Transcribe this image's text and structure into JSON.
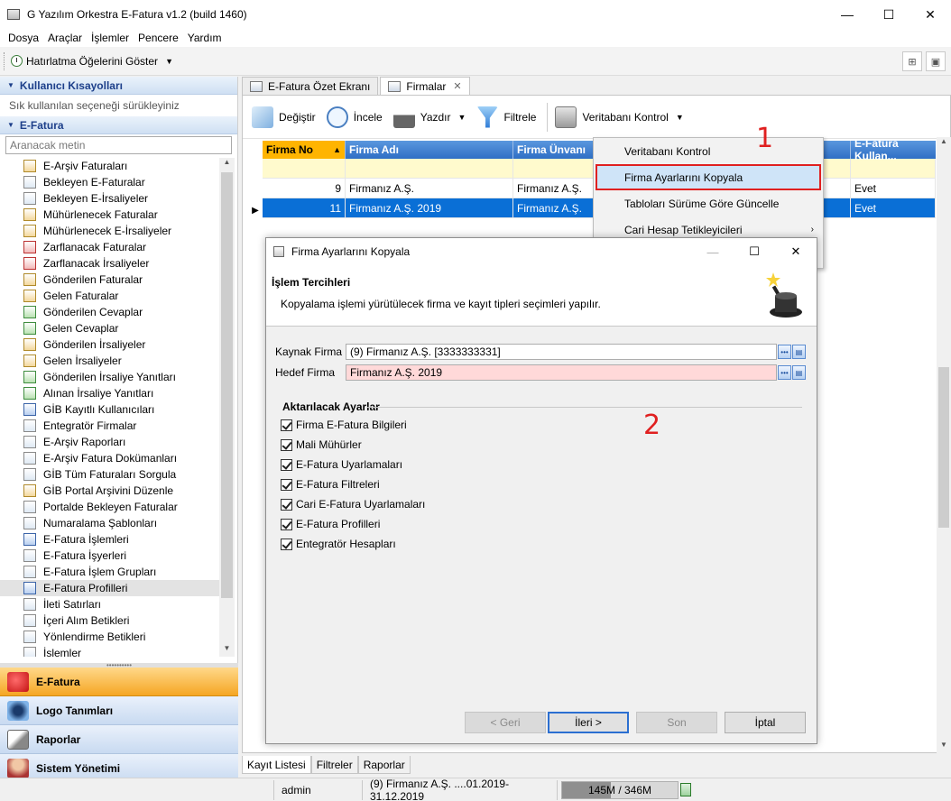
{
  "window": {
    "title": "G Yazılım Orkestra E-Fatura v1.2 (build 1460)",
    "minimize": "—",
    "maximize": "☐",
    "close": "✕"
  },
  "menu": [
    "Dosya",
    "Araçlar",
    "İşlemler",
    "Pencere",
    "Yardım"
  ],
  "topbar": {
    "reminder": "Hatırlatma Öğelerini Göster"
  },
  "left": {
    "shortcuts_title": "Kullanıcı Kısayolları",
    "shortcuts_hint": "Sık kullanılan seçeneği sürükleyiniz",
    "efatura_title": "E-Fatura",
    "search_placeholder": "Aranacak metin",
    "items": [
      "E-Arşiv Faturaları",
      "Bekleyen E-Faturalar",
      "Bekleyen E-İrsaliyeler",
      "Mühürlenecek Faturalar",
      "Mühürlenecek E-İrsaliyeler",
      "Zarflanacak Faturalar",
      "Zarflanacak İrsaliyeler",
      "Gönderilen Faturalar",
      "Gelen Faturalar",
      "Gönderilen Cevaplar",
      "Gelen Cevaplar",
      "Gönderilen İrsaliyeler",
      "Gelen İrsaliyeler",
      "Gönderilen İrsaliye Yanıtları",
      "Alınan İrsaliye Yanıtları",
      "GİB Kayıtlı Kullanıcıları",
      "Entegratör Firmalar",
      "E-Arşiv Raporları",
      "E-Arşiv Fatura Dokümanları",
      "GİB Tüm Faturaları Sorgula",
      "GİB Portal Arşivini Düzenle",
      "Portalde Bekleyen Faturalar",
      "Numaralama Şablonları",
      "E-Fatura İşlemleri",
      "E-Fatura İşyerleri",
      "E-Fatura İşlem Grupları",
      "E-Fatura Profilleri",
      "İleti Satırları",
      "İçeri Alım Betikleri",
      "Yönlendirme Betikleri",
      "İşlemler"
    ],
    "nav": [
      "E-Fatura",
      "Logo Tanımları",
      "Raporlar",
      "Sistem Yönetimi"
    ]
  },
  "tabs": [
    "E-Fatura Özet Ekranı",
    "Firmalar"
  ],
  "toolbar": {
    "change": "Değiştir",
    "inspect": "İncele",
    "print": "Yazdır",
    "filter": "Filtrele",
    "db_check": "Veritabanı Kontrol"
  },
  "grid": {
    "headers": [
      "Firma No",
      "Firma Adı",
      "Firma Ünvanı",
      "E-Fatura Kullan..."
    ],
    "rows": [
      {
        "no": "9",
        "name": "Firmanız A.Ş.",
        "title": "Firmanız A.Ş.",
        "use": "Evet"
      },
      {
        "no": "11",
        "name": "Firmanız A.Ş. 2019",
        "title": "Firmanız A.Ş.",
        "use": "Evet"
      }
    ]
  },
  "context_menu": [
    "Veritabanı Kontrol",
    "Firma Ayarlarını Kopyala",
    "Tabloları Sürüme Göre Güncelle",
    "Cari Hesap Tetikleyicileri"
  ],
  "markers": {
    "one": "1",
    "two": "2"
  },
  "dialog": {
    "title": "Firma Ayarlarını Kopyala",
    "heading": "İşlem Tercihleri",
    "description": "Kopyalama işlemi yürütülecek firma ve kayıt tipleri seçimleri yapılır.",
    "source_label": "Kaynak Firma",
    "source_value": "(9) Firmanız A.Ş. [3333333331]",
    "target_label": "Hedef Firma",
    "target_value": "Firmanız A.Ş. 2019",
    "group_title": "Aktarılacak Ayarlar",
    "options": [
      "Firma E-Fatura Bilgileri",
      "Mali Mühürler",
      "E-Fatura Uyarlamaları",
      "E-Fatura Filtreleri",
      "Cari E-Fatura Uyarlamaları",
      "E-Fatura Profilleri",
      "Entegratör Hesapları"
    ],
    "buttons": {
      "back": "< Geri",
      "next": "İleri >",
      "finish": "Son",
      "cancel": "İptal"
    }
  },
  "bottom_tabs": [
    "Kayıt Listesi",
    "Filtreler",
    "Raporlar"
  ],
  "status": {
    "user": "admin",
    "company": "(9) Firmanız A.Ş.   ....01.2019-31.12.2019",
    "memory": "145M / 346M",
    "memory_fraction": 0.42
  }
}
